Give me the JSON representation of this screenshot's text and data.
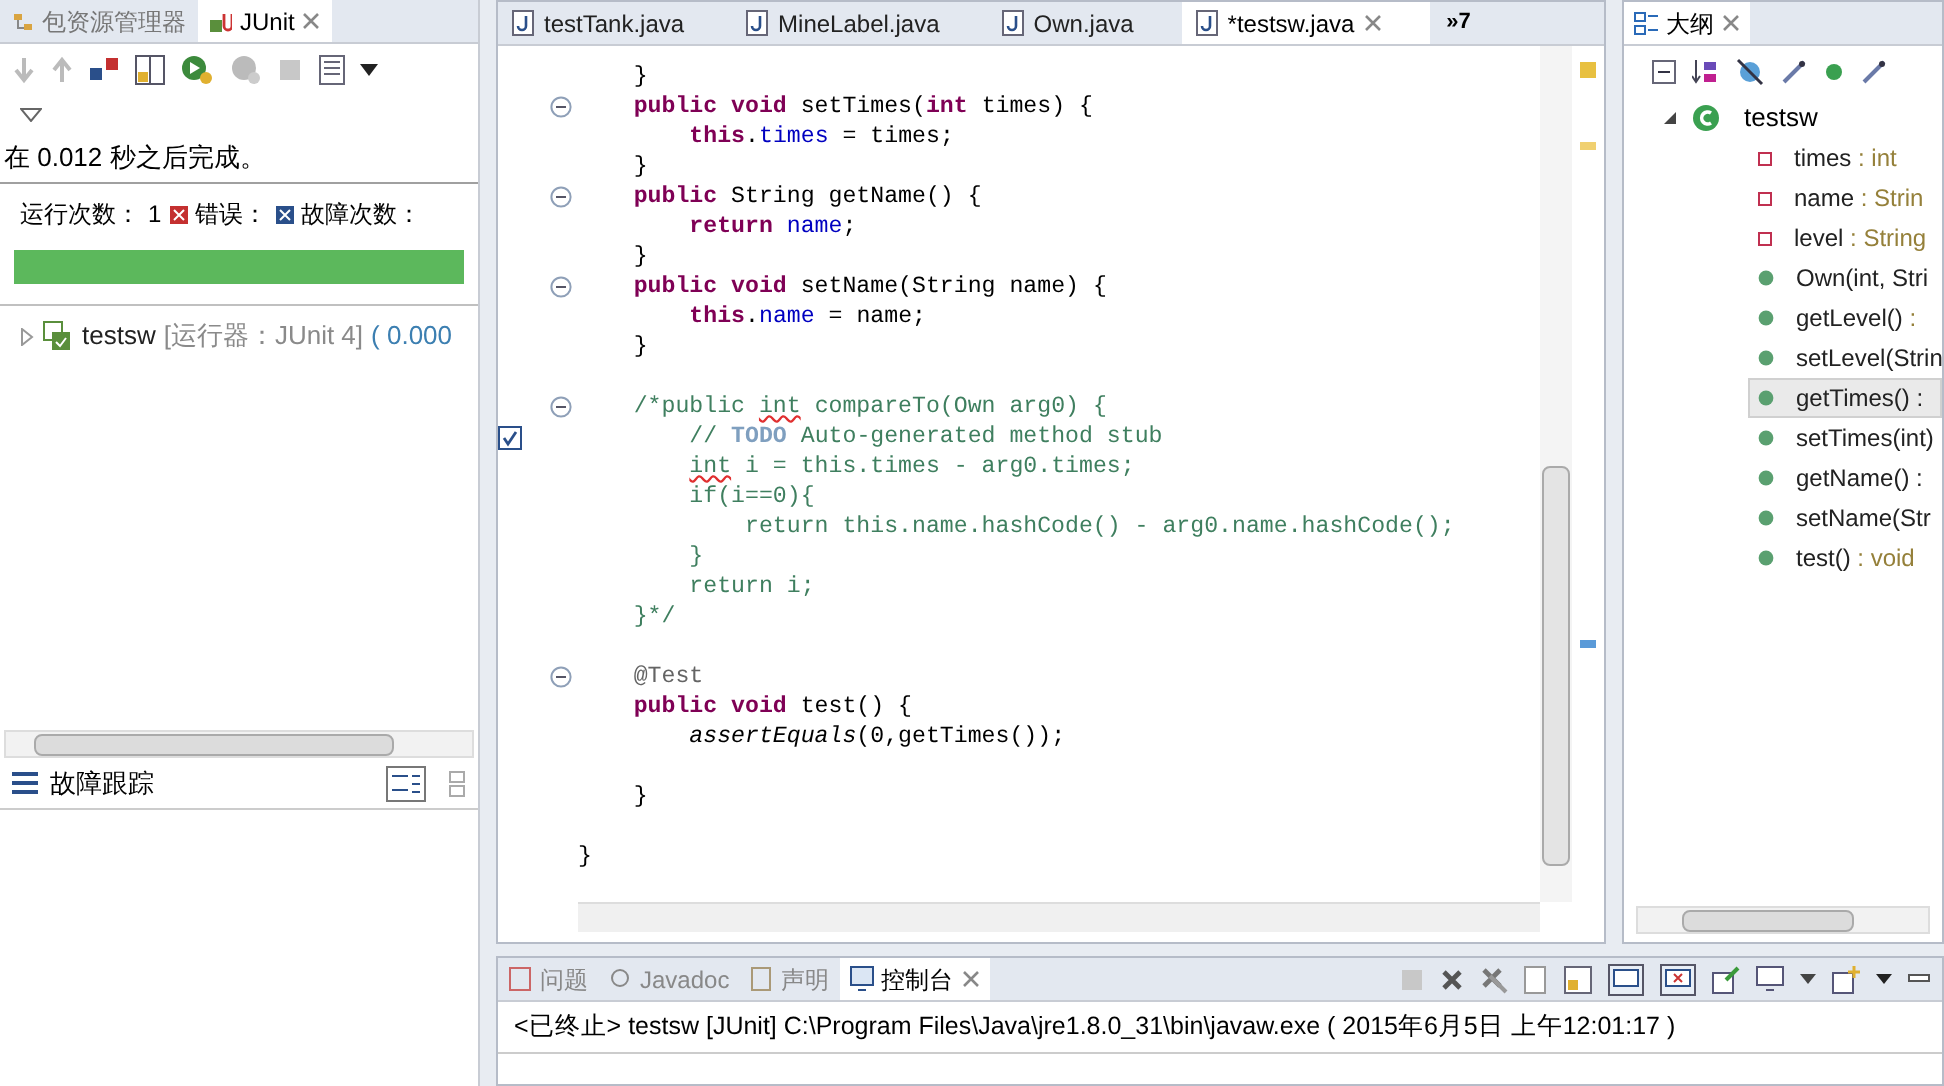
{
  "left_panel": {
    "tabs": [
      {
        "label": "包资源管理器",
        "selected": false
      },
      {
        "label": "JUnit",
        "selected": true
      }
    ],
    "status": "在 0.012 秒之后完成。",
    "counters": [
      {
        "kind": "runs",
        "label": "运行次数：",
        "value": "1"
      },
      {
        "kind": "errors",
        "label": "错误："
      },
      {
        "kind": "failures",
        "label": "故障次数："
      }
    ],
    "progress": {
      "level": 1
    },
    "tree": [
      {
        "name": "testsw",
        "runner": "[运行器：JUnit 4]",
        "time": "( 0.000",
        "expanded": false
      }
    ],
    "trace_title": "故障跟踪"
  },
  "editor": {
    "tabs": [
      {
        "label": "testTank.java",
        "selected": false
      },
      {
        "label": "MineLabel.java",
        "selected": false
      },
      {
        "label": "Own.java",
        "selected": false
      },
      {
        "label": "*testsw.java",
        "selected": true
      }
    ],
    "overflow": "»7",
    "lines": [
      {
        "fold": false,
        "tokens": [
          {
            "kind": "plain",
            "text": "    }"
          }
        ]
      },
      {
        "fold": true,
        "tokens": [
          {
            "kind": "kw",
            "text": "    public void "
          },
          {
            "kind": "plain",
            "text": "setTimes("
          },
          {
            "kind": "kw",
            "text": "int"
          },
          {
            "kind": "plain",
            "text": " times) {"
          }
        ]
      },
      {
        "fold": false,
        "tokens": [
          {
            "kind": "kw",
            "text": "        this"
          },
          {
            "kind": "plain",
            "text": "."
          },
          {
            "kind": "field",
            "text": "times"
          },
          {
            "kind": "plain",
            "text": " = times;"
          }
        ]
      },
      {
        "fold": false,
        "tokens": [
          {
            "kind": "plain",
            "text": "    }"
          }
        ]
      },
      {
        "fold": true,
        "tokens": [
          {
            "kind": "kw",
            "text": "    public "
          },
          {
            "kind": "plain",
            "text": "String getName() {"
          }
        ]
      },
      {
        "fold": false,
        "tokens": [
          {
            "kind": "kw",
            "text": "        return "
          },
          {
            "kind": "field",
            "text": "name"
          },
          {
            "kind": "plain",
            "text": ";"
          }
        ]
      },
      {
        "fold": false,
        "tokens": [
          {
            "kind": "plain",
            "text": "    }"
          }
        ]
      },
      {
        "fold": true,
        "tokens": [
          {
            "kind": "kw",
            "text": "    public void "
          },
          {
            "kind": "plain",
            "text": "setName(String name) {"
          }
        ]
      },
      {
        "fold": false,
        "tokens": [
          {
            "kind": "kw",
            "text": "        this"
          },
          {
            "kind": "plain",
            "text": "."
          },
          {
            "kind": "field",
            "text": "name"
          },
          {
            "kind": "plain",
            "text": " = name;"
          }
        ]
      },
      {
        "fold": false,
        "tokens": [
          {
            "kind": "plain",
            "text": "    }"
          }
        ]
      },
      {
        "fold": false
      },
      {
        "fold": true,
        "tokens": [
          {
            "kind": "comment",
            "text": "    /*public "
          },
          {
            "kind": "comment-err",
            "text": "int"
          },
          {
            "kind": "comment",
            "text": " compareTo(Own arg0) {"
          }
        ]
      },
      {
        "fold": false,
        "task": true,
        "tokens": [
          {
            "kind": "comment",
            "text": "        // "
          },
          {
            "kind": "todo",
            "text": "TODO"
          },
          {
            "kind": "comment",
            "text": " Auto-generated method stub"
          }
        ]
      },
      {
        "fold": false,
        "tokens": [
          {
            "kind": "comment-err",
            "text": "        int"
          },
          {
            "kind": "comment",
            "text": " i = this.times - arg0.times;"
          }
        ]
      },
      {
        "fold": false,
        "tokens": [
          {
            "kind": "comment",
            "text": "        if(i==0){"
          }
        ]
      },
      {
        "fold": false,
        "tokens": [
          {
            "kind": "comment",
            "text": "            return this.name.hashCode() - arg0.name.hashCode();"
          }
        ]
      },
      {
        "fold": false,
        "tokens": [
          {
            "kind": "comment",
            "text": "        }"
          }
        ]
      },
      {
        "fold": false,
        "tokens": [
          {
            "kind": "comment",
            "text": "        return i;"
          }
        ]
      },
      {
        "fold": false,
        "tokens": [
          {
            "kind": "comment",
            "text": "    }*/"
          }
        ]
      },
      {
        "fold": false
      },
      {
        "fold": true,
        "tokens": [
          {
            "kind": "ann",
            "text": "    @Test"
          }
        ]
      },
      {
        "fold": false,
        "tokens": [
          {
            "kind": "kw",
            "text": "    public void "
          },
          {
            "kind": "plain",
            "text": "test() {"
          }
        ]
      },
      {
        "fold": false,
        "tokens": [
          {
            "kind": "static",
            "text": "        assertEquals"
          },
          {
            "kind": "plain",
            "text": "(0,getTimes());"
          }
        ]
      },
      {
        "fold": false
      },
      {
        "fold": false,
        "tokens": [
          {
            "kind": "plain",
            "text": "    }"
          }
        ]
      },
      {
        "fold": false
      },
      {
        "fold": false,
        "tokens": [
          {
            "kind": "plain",
            "text": "}"
          }
        ]
      }
    ]
  },
  "outline": {
    "tab": "大纲",
    "class_name": "testsw",
    "members": [
      {
        "kind": "field",
        "name": "times",
        "type": " : int",
        "selected": false
      },
      {
        "kind": "field",
        "name": "name",
        "type": " : Strin",
        "selected": false
      },
      {
        "kind": "field",
        "name": "level",
        "type": " : String",
        "selected": false
      },
      {
        "kind": "method",
        "name": "Own(int, Stri",
        "selected": false
      },
      {
        "kind": "method",
        "name": "getLevel()",
        "type": " :",
        "selected": false
      },
      {
        "kind": "method",
        "name": "setLevel(Strin",
        "selected": false
      },
      {
        "kind": "method",
        "name": "getTimes() :",
        "selected": true
      },
      {
        "kind": "method",
        "name": "setTimes(int)",
        "selected": false
      },
      {
        "kind": "method",
        "name": "getName() :",
        "selected": false
      },
      {
        "kind": "method",
        "name": "setName(Str",
        "selected": false
      },
      {
        "kind": "method",
        "name": "test()",
        "type": " : void",
        "selected": false
      }
    ]
  },
  "console": {
    "tabs": [
      {
        "label": "问题",
        "selected": false
      },
      {
        "label": "Javadoc",
        "selected": false
      },
      {
        "label": "声明",
        "selected": false
      },
      {
        "label": "控制台",
        "selected": true
      }
    ],
    "output": "<已终止> testsw [JUnit] C:\\Program Files\\Java\\jre1.8.0_31\\bin\\javaw.exe ( 2015年6月5日 上午12:01:17 )"
  }
}
